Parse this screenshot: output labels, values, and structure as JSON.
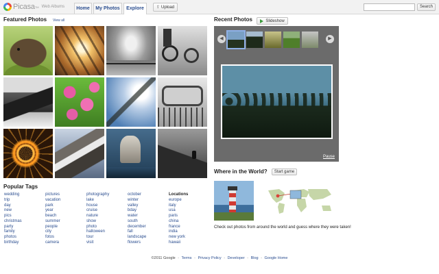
{
  "header": {
    "logo_text": "Picasa",
    "logo_tm": "TM",
    "logo_subtitle": "Web Albums",
    "tabs": [
      {
        "label": "Home"
      },
      {
        "label": "My Photos"
      },
      {
        "label": "Explore"
      }
    ],
    "active_tab": "Explore",
    "upload_label": "Upload",
    "search_placeholder": "",
    "search_value": "",
    "search_button": "Search"
  },
  "featured": {
    "title": "Featured Photos",
    "view_all": "View all",
    "photos": [
      {
        "icon": "hedgehog"
      },
      {
        "icon": "sunset-through-fence"
      },
      {
        "icon": "stormy-clouds-pier"
      },
      {
        "icon": "bicycles-bw"
      },
      {
        "icon": "mountain-cliff-bw"
      },
      {
        "icon": "pink-flowers"
      },
      {
        "icon": "tree-sky"
      },
      {
        "icon": "observation-wheel"
      },
      {
        "icon": "light-painting-orb"
      },
      {
        "icon": "rocky-islet"
      },
      {
        "icon": "heron-catching-fish"
      },
      {
        "icon": "person-on-rock"
      }
    ]
  },
  "tags": {
    "title": "Popular Tags",
    "columns": [
      [
        "wedding",
        "trip",
        "day",
        "new",
        "pics",
        "christmas",
        "party",
        "family",
        "photos",
        "birthday"
      ],
      [
        "pictures",
        "vacation",
        "park",
        "year",
        "beach",
        "summer",
        "people",
        "city",
        "fotos",
        "camera"
      ],
      [
        "photography",
        "lake",
        "house",
        "cruise",
        "nature",
        "show",
        "photo",
        "halloween",
        "tour",
        "visit"
      ],
      [
        "october",
        "winter",
        "valley",
        "bday",
        "water",
        "south",
        "december",
        "fall",
        "landscape",
        "flowers"
      ]
    ],
    "locations_title": "Locations",
    "locations": [
      "europe",
      "italy",
      "usa",
      "paris",
      "china",
      "france",
      "india",
      "new york",
      "hawaii"
    ]
  },
  "recent": {
    "title": "Recent Photos",
    "slideshow_label": "Slideshow",
    "prev_icon": "chevron-left-icon",
    "next_icon": "chevron-right-icon",
    "strip": [
      {
        "icon": "lake-forest"
      },
      {
        "icon": "dark-forest"
      },
      {
        "icon": "sunny-trees"
      },
      {
        "icon": "green-field"
      },
      {
        "icon": "misty-trees"
      }
    ],
    "selected_index": 0,
    "pause_label": "Pause"
  },
  "world": {
    "title": "Where in the World?",
    "start_label": "Start game",
    "caption": "Check out photos from around the world and guess where they were taken!"
  },
  "footer": {
    "copyright": "©2011 Google",
    "links": [
      "Terms",
      "Privacy Policy",
      "Developer",
      "Blog",
      "Google Home"
    ]
  },
  "colors": {
    "link": "#2a4d8f",
    "viewer_bg": "#6b6b6b",
    "topbar_bg": "#f2f2f2"
  }
}
